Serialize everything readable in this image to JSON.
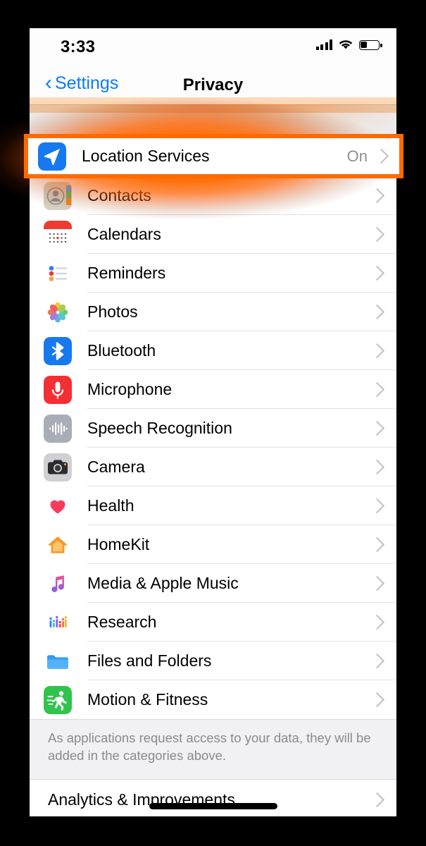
{
  "status_bar": {
    "time": "3:33",
    "signal_icon": "cellular-bars-icon",
    "wifi_icon": "wifi-icon",
    "battery_icon": "battery-icon",
    "battery_level_pct": 33
  },
  "nav": {
    "back_label": "Settings",
    "back_icon": "chevron-left-icon",
    "title": "Privacy"
  },
  "highlight": {
    "color": "#ff6a00",
    "target": "Location Services"
  },
  "location_row": {
    "label": "Location Services",
    "value": "On",
    "icon": "location-arrow-icon",
    "chevron_icon": "chevron-right-icon"
  },
  "rows": [
    {
      "label": "Contacts",
      "icon": "contacts-icon",
      "chevron_icon": "chevron-right-icon"
    },
    {
      "label": "Calendars",
      "icon": "calendar-icon",
      "chevron_icon": "chevron-right-icon"
    },
    {
      "label": "Reminders",
      "icon": "reminders-icon",
      "chevron_icon": "chevron-right-icon"
    },
    {
      "label": "Photos",
      "icon": "photos-icon",
      "chevron_icon": "chevron-right-icon"
    },
    {
      "label": "Bluetooth",
      "icon": "bluetooth-icon",
      "chevron_icon": "chevron-right-icon"
    },
    {
      "label": "Microphone",
      "icon": "microphone-icon",
      "chevron_icon": "chevron-right-icon"
    },
    {
      "label": "Speech Recognition",
      "icon": "waveform-icon",
      "chevron_icon": "chevron-right-icon"
    },
    {
      "label": "Camera",
      "icon": "camera-icon",
      "chevron_icon": "chevron-right-icon"
    },
    {
      "label": "Health",
      "icon": "heart-icon",
      "chevron_icon": "chevron-right-icon"
    },
    {
      "label": "HomeKit",
      "icon": "house-icon",
      "chevron_icon": "chevron-right-icon"
    },
    {
      "label": "Media & Apple Music",
      "icon": "music-note-icon",
      "chevron_icon": "chevron-right-icon"
    },
    {
      "label": "Research",
      "icon": "bar-chart-icon",
      "chevron_icon": "chevron-right-icon"
    },
    {
      "label": "Files and Folders",
      "icon": "folder-icon",
      "chevron_icon": "chevron-right-icon"
    },
    {
      "label": "Motion & Fitness",
      "icon": "running-icon",
      "chevron_icon": "chevron-right-icon"
    }
  ],
  "footer_note": "As applications request access to your data, they will be added in the categories above.",
  "bottom_row": {
    "label": "Analytics & Improvements",
    "chevron_icon": "chevron-right-icon"
  }
}
